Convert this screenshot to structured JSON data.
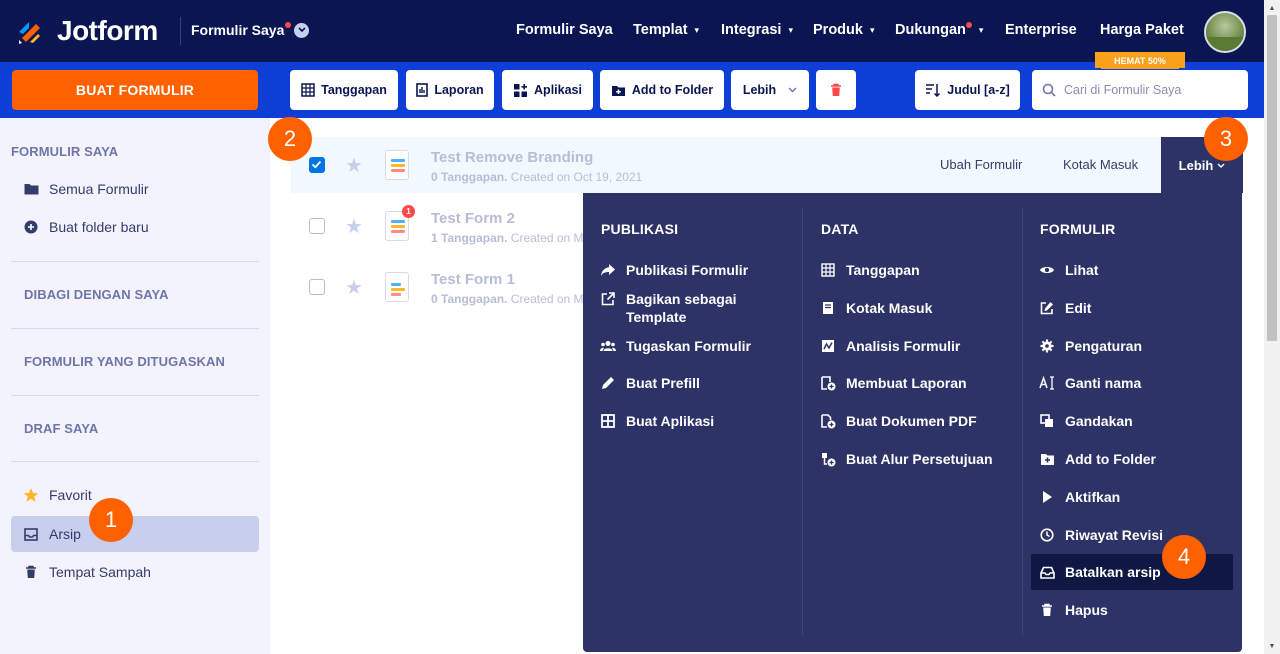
{
  "brand": {
    "name": "Jotform",
    "accent": "#ff6100",
    "nav_bg": "#0a1551",
    "toolbar_bg": "#0d3fd7",
    "menu_bg": "#2d3366"
  },
  "nav": {
    "context": "Formulir Saya",
    "links": [
      {
        "label": "Formulir Saya"
      },
      {
        "label": "Templat"
      },
      {
        "label": "Integrasi"
      },
      {
        "label": "Produk"
      },
      {
        "label": "Dukungan"
      },
      {
        "label": "Enterprise"
      },
      {
        "label": "Harga Paket"
      }
    ],
    "promo_badge": "HEMAT 50%"
  },
  "toolbar": {
    "create_label": "BUAT FORMULIR",
    "tanggapan": "Tanggapan",
    "laporan": "Laporan",
    "aplikasi": "Aplikasi",
    "add_to_folder": "Add to Folder",
    "lebih": "Lebih",
    "sort_label": "Judul [a-z]",
    "search_placeholder": "Cari di Formulir Saya"
  },
  "sidebar": {
    "section_my_forms": "FORMULIR SAYA",
    "all_forms": "Semua Formulir",
    "new_folder": "Buat folder baru",
    "shared": "DIBAGI DENGAN SAYA",
    "assigned": "FORMULIR YANG DITUGASKAN",
    "drafts": "DRAF SAYA",
    "favorites": "Favorit",
    "archive": "Arsip",
    "trash": "Tempat Sampah"
  },
  "forms": [
    {
      "title": "Test Remove Branding",
      "responses": "0 Tanggapan.",
      "created": "Created on Oct 19, 2021",
      "selected": true
    },
    {
      "title": "Test Form 2",
      "responses": "1 Tanggapan.",
      "created": "Created on M",
      "selected": false,
      "badge": "1"
    },
    {
      "title": "Test Form 1",
      "responses": "0 Tanggapan.",
      "created": "Created on M",
      "selected": false
    }
  ],
  "row_actions": {
    "edit": "Ubah Formulir",
    "inbox": "Kotak Masuk",
    "more": "Lebih"
  },
  "menu": {
    "publikasi": {
      "title": "PUBLIKASI",
      "items": [
        "Publikasi Formulir",
        "Bagikan sebagai Template",
        "Tugaskan Formulir",
        "Buat Prefill",
        "Buat Aplikasi"
      ]
    },
    "data": {
      "title": "DATA",
      "items": [
        "Tanggapan",
        "Kotak Masuk",
        "Analisis Formulir",
        "Membuat Laporan",
        "Buat Dokumen PDF",
        "Buat Alur Persetujuan"
      ]
    },
    "formulir": {
      "title": "FORMULIR",
      "items": [
        "Lihat",
        "Edit",
        "Pengaturan",
        "Ganti nama",
        "Gandakan",
        "Add to Folder",
        "Aktifkan",
        "Riwayat Revisi",
        "Batalkan arsip",
        "Hapus"
      ]
    }
  },
  "markers": [
    "1",
    "2",
    "3",
    "4"
  ]
}
